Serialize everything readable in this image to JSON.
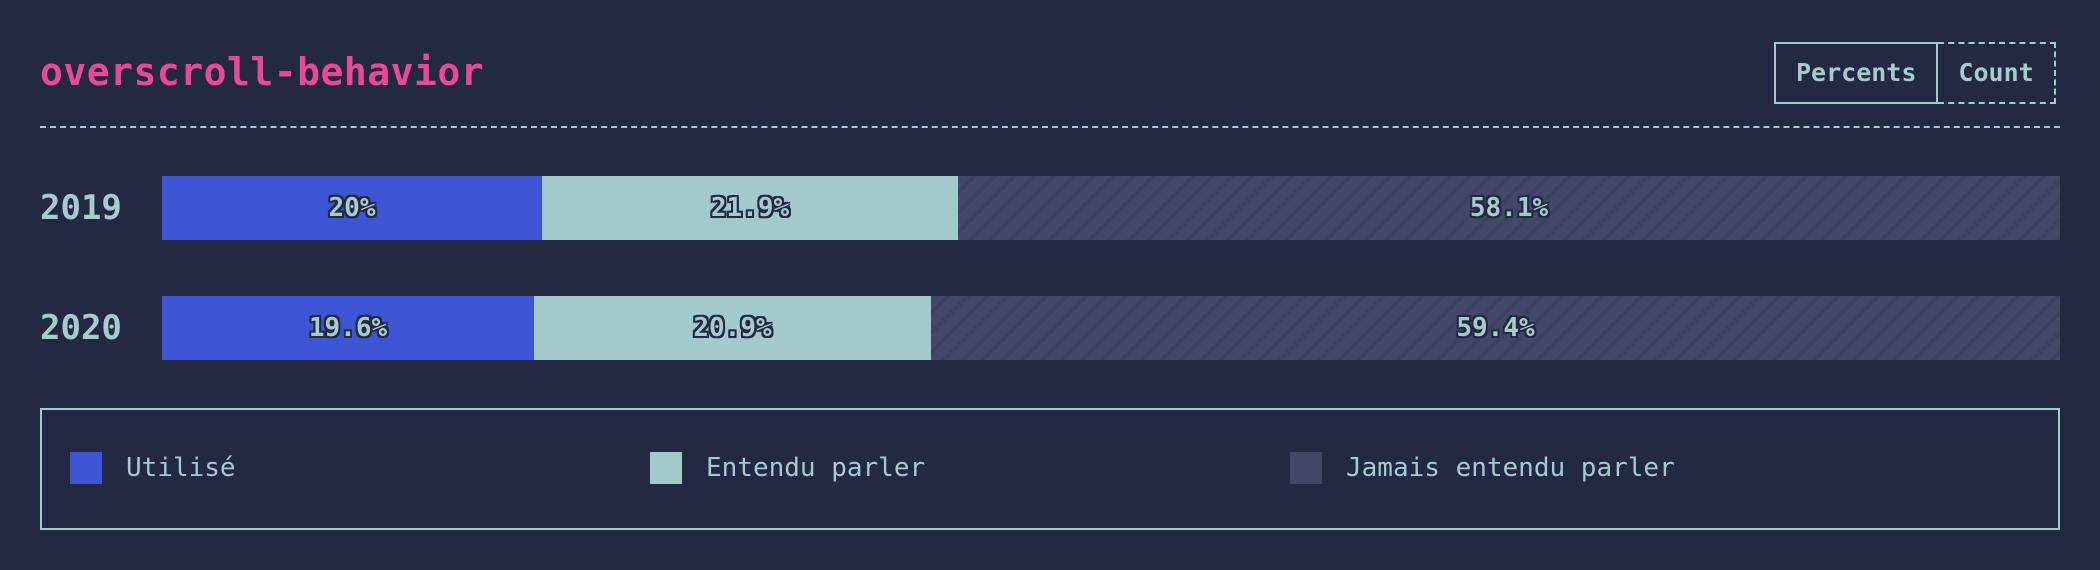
{
  "header": {
    "title": "overscroll-behavior",
    "toggle": {
      "percents_label": "Percents",
      "count_label": "Count"
    }
  },
  "colors": {
    "background": "#232843",
    "title": "#ec4899",
    "text": "#a6cbcd",
    "used": "#3e55d6",
    "heard": "#a2cacd",
    "never": "#434869"
  },
  "chart_data": {
    "type": "bar",
    "stacked": true,
    "orientation": "horizontal",
    "title": "overscroll-behavior",
    "categories": [
      "2019",
      "2020"
    ],
    "series": [
      {
        "name": "Utilisé",
        "values": [
          20,
          19.6
        ],
        "labels": [
          "20%",
          "19.6%"
        ],
        "color": "#3e55d6"
      },
      {
        "name": "Entendu parler",
        "values": [
          21.9,
          20.9
        ],
        "labels": [
          "21.9%",
          "20.9%"
        ],
        "color": "#a2cacd"
      },
      {
        "name": "Jamais entendu parler",
        "values": [
          58.1,
          59.4
        ],
        "labels": [
          "58.1%",
          "59.4%"
        ],
        "color": "#434869",
        "pattern": "diagonal-stripes"
      }
    ],
    "xlim": [
      0,
      100
    ],
    "legend_position": "bottom"
  }
}
